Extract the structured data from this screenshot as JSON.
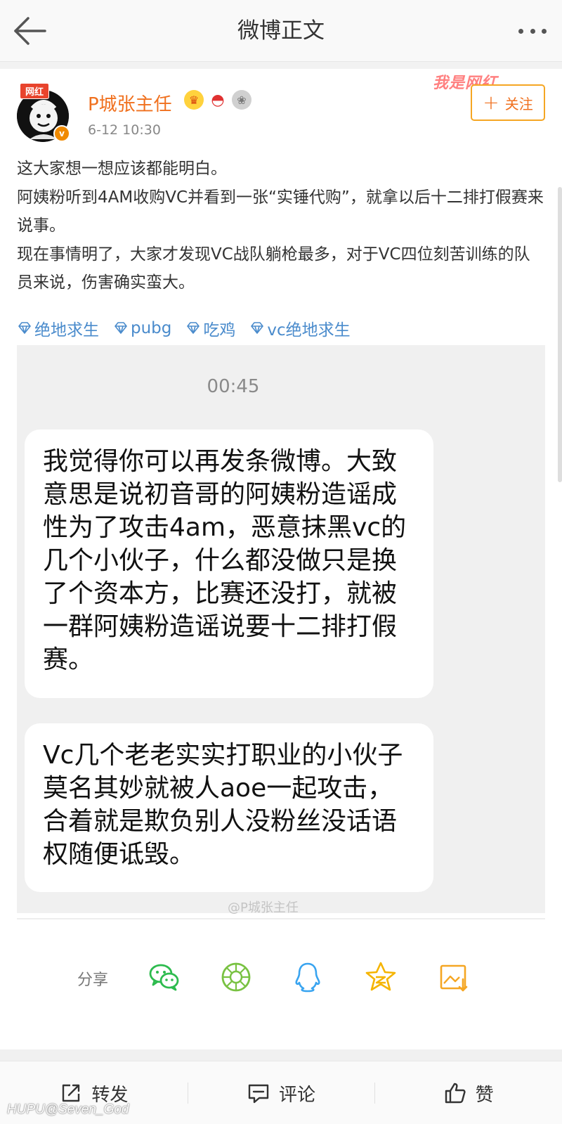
{
  "header": {
    "title": "微博正文"
  },
  "post": {
    "author": {
      "name": "P城张主任",
      "avatar_tag": "网红",
      "verified_mark": "v",
      "badges": [
        "crown-icon",
        "watermelon-icon",
        "medal-icon"
      ]
    },
    "time": "6-12 10:30",
    "banner_watermark": "我是网红",
    "follow_label": "关注",
    "paragraphs": [
      "这大家想一想应该都能明白。",
      "阿姨粉听到4AM收购VC并看到一张“实锤代购”，就拿以后十二排打假赛来说事。",
      "现在事情明了，大家才发现VC战队躺枪最多，对于VC四位刻苦训练的队员来说，伤害确实蛮大。"
    ],
    "topics": [
      "绝地求生",
      "pubg",
      "吃鸡",
      "vc绝地求生"
    ]
  },
  "image": {
    "time": "00:45",
    "messages": [
      "我觉得你可以再发条微博。大致意思是说初音哥的阿姨粉造谣成性为了攻击4am，恶意抹黑vc的几个小伙子，什么都没做只是换了个资本方，比赛还没打，就被一群阿姨粉造谣说要十二排打假赛。",
      "Vc几个老老实实打职业的小伙子莫名其妙就被人aoe一起攻击，合着就是欺负别人没粉丝没话语权随便诋毁。"
    ],
    "watermark": "@P城张主任"
  },
  "share": {
    "label": "分享",
    "targets": [
      "wechat-icon",
      "moments-icon",
      "qq-icon",
      "qzone-icon",
      "save-image-icon"
    ]
  },
  "actions": {
    "repost": "转发",
    "comment": "评论",
    "like": "赞"
  },
  "footer_watermark": "HUPU@Seven_God",
  "colors": {
    "username": "#f0701e",
    "follow_border": "#f5a623",
    "topic": "#4a8bcc",
    "wechat": "#2dbb4e",
    "qq": "#39a4f0",
    "qzone": "#f5b400",
    "save": "#f5a623"
  }
}
